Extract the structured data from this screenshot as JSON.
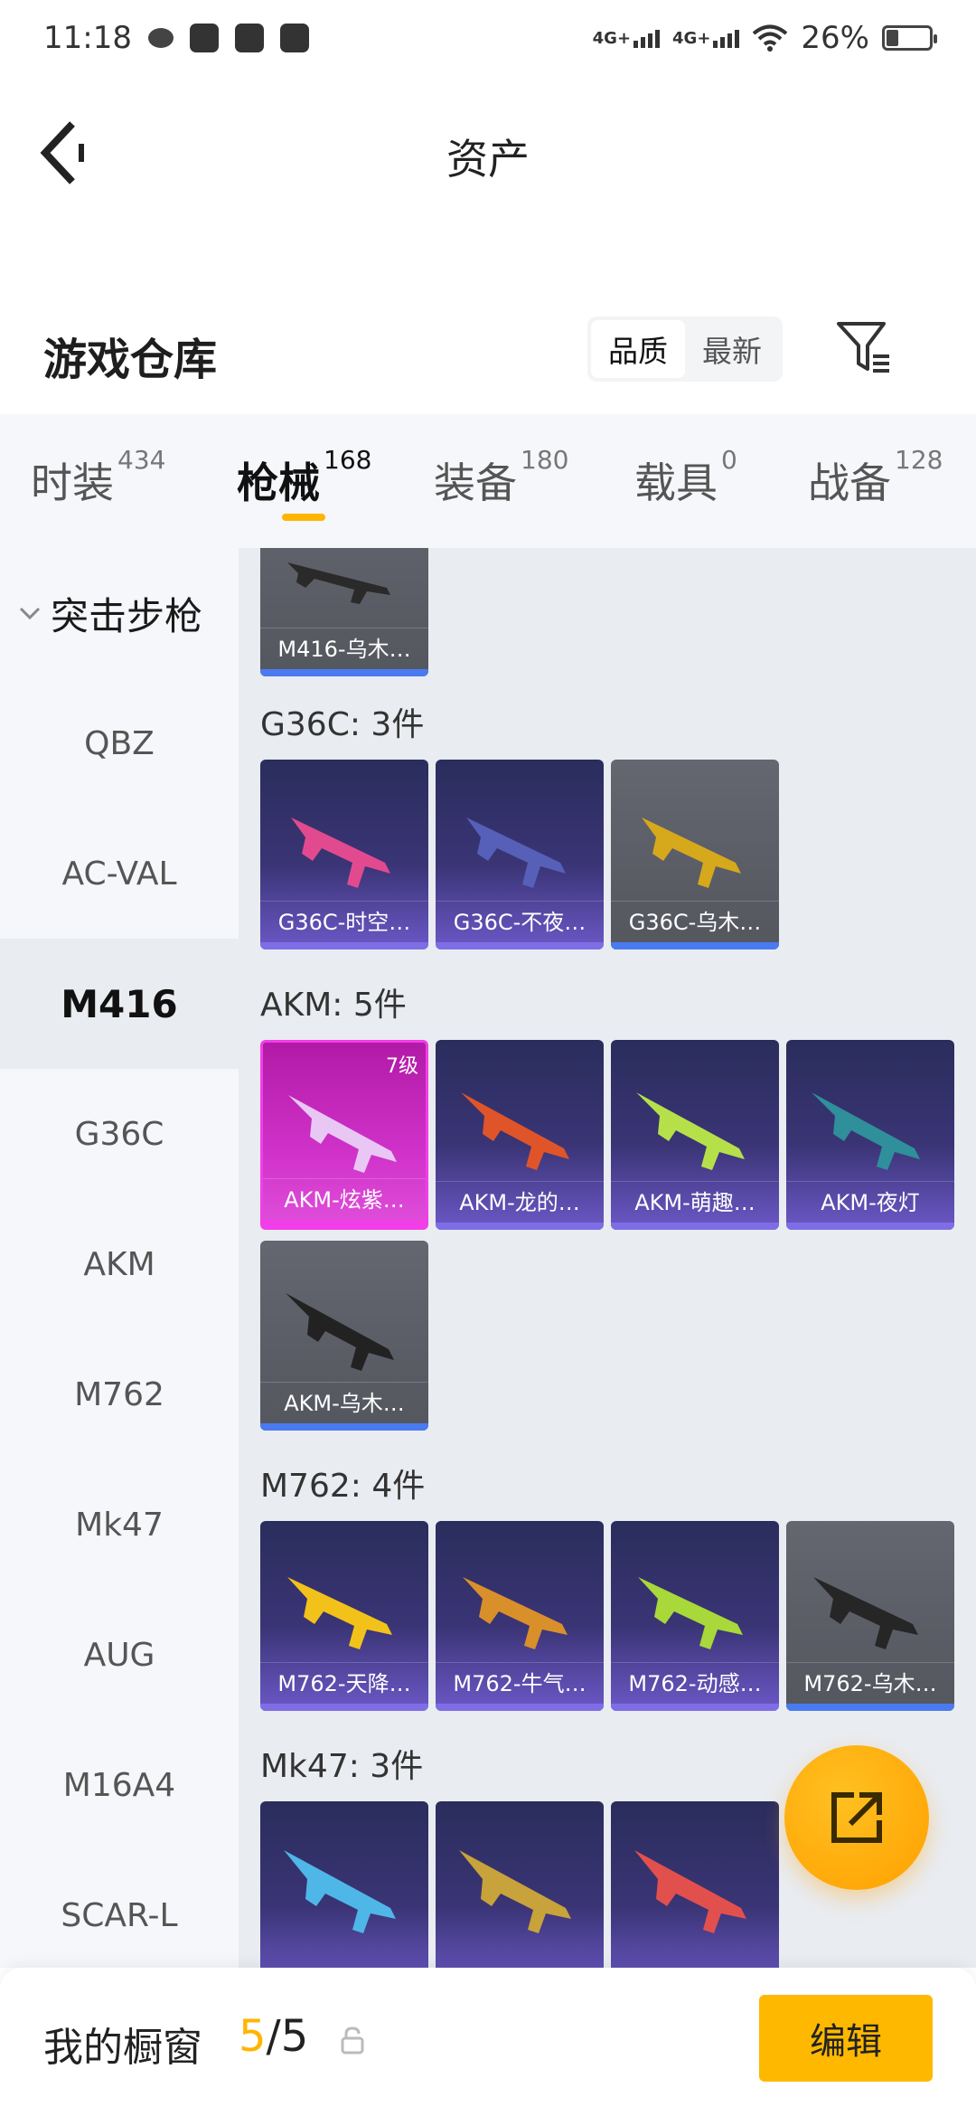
{
  "status_bar": {
    "time": "11:18",
    "network_1": "4G+",
    "network_2": "4G+",
    "battery": "26%"
  },
  "header": {
    "title": "资产"
  },
  "section": {
    "title": "游戏仓库",
    "sort_options": [
      "品质",
      "最新"
    ],
    "active_sort": "品质"
  },
  "tabs": [
    {
      "label": "时装",
      "count": "434"
    },
    {
      "label": "枪械",
      "count": "168"
    },
    {
      "label": "装备",
      "count": "180"
    },
    {
      "label": "载具",
      "count": "0"
    },
    {
      "label": "战备",
      "count": "128"
    }
  ],
  "active_tab": "枪械",
  "sidebar": {
    "group": "突击步枪",
    "items": [
      "QBZ",
      "AC-VAL",
      "M416",
      "G36C",
      "AKM",
      "M762",
      "Mk47",
      "AUG",
      "M16A4",
      "SCAR-L"
    ],
    "active": "M416"
  },
  "content": {
    "m416_partial": {
      "caption": "M416-乌木…",
      "quality": "gray"
    },
    "groups": [
      {
        "label": "G36C: 3件",
        "items": [
          {
            "caption": "G36C-时空…",
            "quality": "purple"
          },
          {
            "caption": "G36C-不夜…",
            "quality": "purple"
          },
          {
            "caption": "G36C-乌木…",
            "quality": "gray"
          }
        ]
      },
      {
        "label": "AKM: 5件",
        "items": [
          {
            "caption": "AKM-炫紫…",
            "quality": "magenta",
            "level": "7级"
          },
          {
            "caption": "AKM-龙的…",
            "quality": "purple"
          },
          {
            "caption": "AKM-萌趣…",
            "quality": "purple"
          },
          {
            "caption": "AKM-夜灯",
            "quality": "purple"
          },
          {
            "caption": "AKM-乌木…",
            "quality": "gray"
          }
        ]
      },
      {
        "label": "M762: 4件",
        "items": [
          {
            "caption": "M762-天降…",
            "quality": "purple"
          },
          {
            "caption": "M762-牛气…",
            "quality": "purple"
          },
          {
            "caption": "M762-动感…",
            "quality": "purple"
          },
          {
            "caption": "M762-乌木…",
            "quality": "gray"
          }
        ]
      },
      {
        "label": "Mk47: 3件",
        "items": [
          {
            "caption": "",
            "quality": "purple"
          },
          {
            "caption": "",
            "quality": "purple"
          },
          {
            "caption": "",
            "quality": "purple"
          }
        ]
      }
    ]
  },
  "bottom": {
    "label": "我的橱窗",
    "used": "5",
    "separator": "/",
    "total": "5",
    "edit_label": "编辑"
  },
  "colors": {
    "accent": "#ffb400",
    "legendary": "#f23ee6",
    "epic": "#7f6de6",
    "common_bar": "#4a7af0",
    "sidebar_bg": "#f5f7fa",
    "content_bg": "#e9ecf1"
  }
}
